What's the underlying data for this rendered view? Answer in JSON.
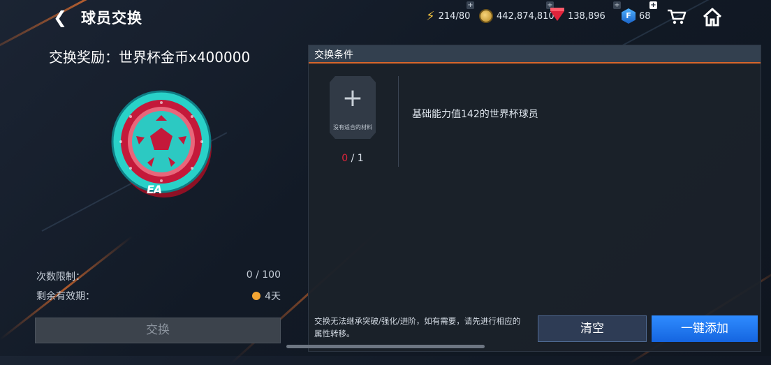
{
  "header": {
    "title": "球员交换",
    "energy": "214/80",
    "coins": "442,874,810",
    "gems": "138,896",
    "f_points": "68"
  },
  "reward": {
    "label": "交换奖励：世界杯金币x400000",
    "logo_text": "EA"
  },
  "limits": {
    "count_label": "次数限制：",
    "count_value": "0 / 100",
    "expiry_label": "剩余有效期：",
    "expiry_value": "4天"
  },
  "exchange_button": "交换",
  "panel": {
    "header": "交换条件",
    "slot_plus": "+",
    "slot_label": "没有适合的材料",
    "slot_count_current": "0",
    "slot_count_total": " / 1",
    "requirement": "基础能力值142的世界杯球员",
    "note": "交换无法继承突破/强化/进阶，如有需要，请先进行相应的属性转移。",
    "clear_button": "清空",
    "add_button": "一键添加"
  },
  "icons": [
    "back-icon",
    "energy-icon",
    "coin-icon",
    "gem-icon",
    "f-point-icon",
    "cart-icon",
    "home-icon",
    "timer-icon"
  ],
  "colors": {
    "accent_orange": "#d8662b",
    "primary_blue": "#1f7bf2",
    "alert_red": "#e0243b"
  }
}
